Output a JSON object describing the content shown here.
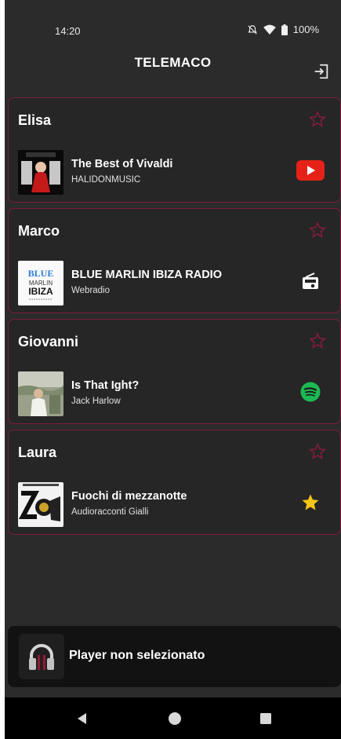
{
  "status_bar": {
    "time": "14:20",
    "battery_text": "100%",
    "icons": [
      "notifications-off-icon",
      "wifi-icon",
      "battery-icon"
    ]
  },
  "header": {
    "title": "TELEMACO",
    "logout_icon": "logout-icon"
  },
  "cards": [
    {
      "user": "Elisa",
      "title": "The Best of Vivaldi",
      "subtitle": "HALIDONMUSIC",
      "source": "youtube",
      "favorite": false
    },
    {
      "user": "Marco",
      "title": "BLUE MARLIN IBIZA RADIO",
      "subtitle": "Webradio",
      "source": "webradio",
      "favorite": false
    },
    {
      "user": "Giovanni",
      "title": "Is That Ight?",
      "subtitle": "Jack Harlow",
      "source": "spotify",
      "favorite": false
    },
    {
      "user": "Laura",
      "title": "Fuochi di mezzanotte",
      "subtitle": "Audioracconti Gialli",
      "source": "audiobook",
      "favorite": false
    }
  ],
  "cover_texts": {
    "blue": "BLUE",
    "marlin": "MARLIN",
    "ibiza": "IBIZA"
  },
  "player": {
    "label": "Player non selezionato",
    "icon": "headphones-icon"
  },
  "colors": {
    "background": "#2b2b2b",
    "card_border": "#7d1d3a",
    "youtube": "#e62117",
    "spotify": "#1db954",
    "star_gold": "#f5c518",
    "player_bg": "#121212"
  },
  "nav": [
    "back-icon",
    "home-icon",
    "recents-icon"
  ]
}
